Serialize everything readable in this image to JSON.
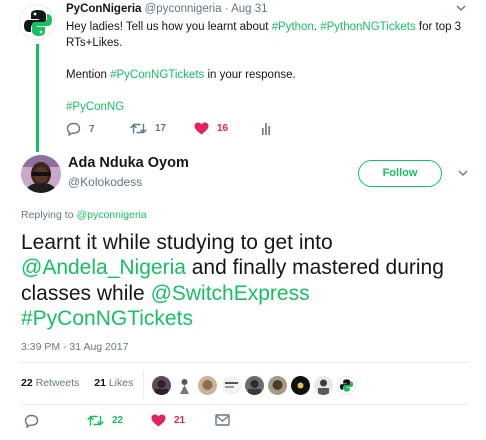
{
  "parent_tweet": {
    "display_name": "PyConNigeria",
    "handle_date": "@pyconnigeria · Aug 31",
    "line1_prefix": "Hey ladies! Tell us how you learnt about ",
    "hashtag_python": "#Python",
    "sep": ". ",
    "hashtag_tickets": "#PythonNGTickets",
    "line1_suffix": " for top 3 RTs+Likes.",
    "mention_prefix": "Mention ",
    "hashtag_pycontickets": "#PyConNGTickets",
    "mention_suffix": " in your response.",
    "hashtag_pyconng": "#PyConNG",
    "replies": "7",
    "retweets": "17",
    "likes": "16"
  },
  "main_tweet": {
    "display_name": "Ada Nduka Oyom",
    "handle": "@Kolokodess",
    "follow_label": "Follow",
    "replying_prefix": "Replying to ",
    "replying_to": "@pyconnigeria",
    "text_1": "Learnt it while studying to get into ",
    "mention_andela": "@Andela_Nigeria",
    "text_2": " and finally mastered during classes while ",
    "mention_switch": "@SwitchExpress",
    "hashtag": "#PyConNGTickets",
    "timestamp": "3:39 PM - 31 Aug 2017",
    "retweet_count": "22",
    "retweet_label": "Retweets",
    "like_count": "21",
    "like_label": "Likes",
    "action_retweets": "22",
    "action_likes": "21"
  },
  "colors": {
    "accent": "#17bf63",
    "like": "#e0245e",
    "muted": "#657786"
  },
  "icons": [
    "reply-icon",
    "retweet-icon",
    "heart-icon",
    "analytics-icon",
    "mail-icon",
    "chevron-down-icon"
  ]
}
